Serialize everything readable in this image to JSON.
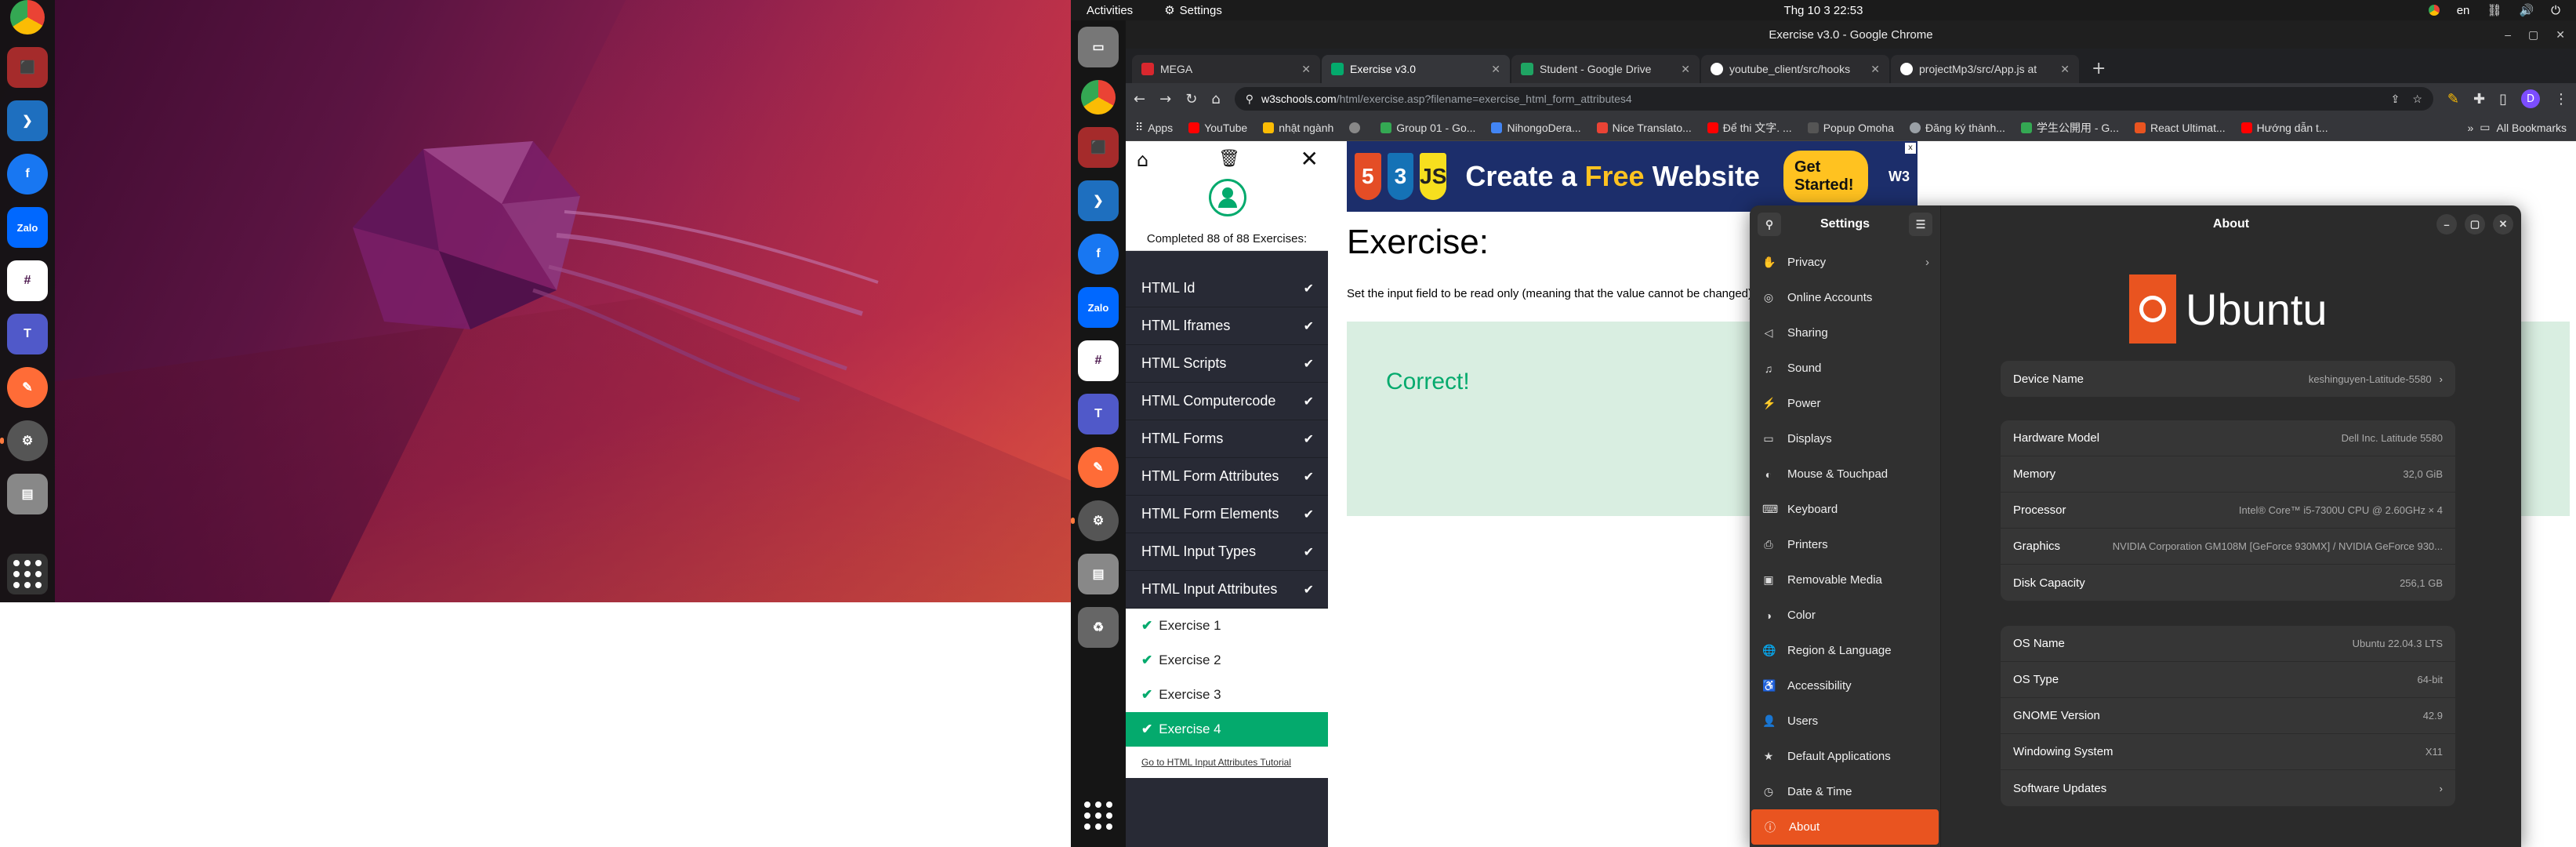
{
  "left_dock": {
    "apps": [
      "chrome-icon",
      "terminal-icon",
      "vscode-icon",
      "facebook-icon",
      "zalo-icon",
      "slack-icon",
      "teams-icon",
      "postman-icon",
      "settings-icon",
      "text-editor-icon"
    ]
  },
  "topbar": {
    "activities": "Activities",
    "app_indicator": "Settings",
    "clock": "Thg 10 3  22:53",
    "lang": "en"
  },
  "chrome": {
    "window_title": "Exercise v3.0 - Google Chrome",
    "tabs": [
      {
        "label": "MEGA",
        "color": "#d9272e"
      },
      {
        "label": "Exercise v3.0",
        "color": "#04aa6d"
      },
      {
        "label": "Student - Google Drive",
        "color": "#1fa463"
      },
      {
        "label": "youtube_client/src/hooks",
        "color": "#ffffff"
      },
      {
        "label": "projectMp3/src/App.js at",
        "color": "#ffffff"
      }
    ],
    "url_host": "w3schools.com",
    "url_path": "/html/exercise.asp?filename=exercise_html_form_attributes4",
    "bookmarks": [
      {
        "label": "Apps",
        "color": "#8ab4f8"
      },
      {
        "label": "YouTube",
        "color": "#ff0000"
      },
      {
        "label": "nhật ngành",
        "color": "#fbbc04"
      },
      {
        "label": "",
        "color": "#888888"
      },
      {
        "label": "Group 01 - Go...",
        "color": "#34a853"
      },
      {
        "label": "NihongoDera...",
        "color": "#4285f4"
      },
      {
        "label": "Nice Translato...",
        "color": "#ea4335"
      },
      {
        "label": "Để thi 文字. ...",
        "color": "#ff0000"
      },
      {
        "label": "Popup Omoha",
        "color": "#555555"
      },
      {
        "label": "Đăng ký thành...",
        "color": "#9aa0a6"
      },
      {
        "label": "学生公開用 - G...",
        "color": "#34a853"
      },
      {
        "label": "React Ultimat...",
        "color": "#e95420"
      },
      {
        "label": "Hướng dẫn t...",
        "color": "#ff0000"
      }
    ],
    "all_bookmarks": "All Bookmarks"
  },
  "exercise": {
    "completed": "Completed 88 of 88 Exercises:",
    "sections": [
      "HTML Id",
      "HTML Iframes",
      "HTML Scripts",
      "HTML Computercode",
      "HTML Forms",
      "HTML Form Attributes",
      "HTML Form Elements",
      "HTML Input Types",
      "HTML Input Attributes"
    ],
    "subitems": [
      "Exercise 1",
      "Exercise 2",
      "Exercise 3",
      "Exercise 4"
    ],
    "goto": "Go to HTML Input Attributes Tutorial",
    "title": "Exercise:",
    "description": "Set the input field to be read only (meaning that the value cannot be changed).",
    "result": "Correct!",
    "ad": {
      "headline_1": "Create a",
      "headline_free": "Free",
      "headline_2": "Website",
      "cta": "Get Started!",
      "brand": "W3",
      "close": "x"
    }
  },
  "settings": {
    "sidebar_title": "Settings",
    "window_title": "About",
    "nav": [
      {
        "label": "Privacy",
        "icon": "privacy-icon",
        "chev": true
      },
      {
        "label": "Online Accounts",
        "icon": "online-accounts-icon"
      },
      {
        "label": "Sharing",
        "icon": "sharing-icon"
      },
      {
        "label": "Sound",
        "icon": "sound-icon"
      },
      {
        "label": "Power",
        "icon": "power-icon"
      },
      {
        "label": "Displays",
        "icon": "displays-icon"
      },
      {
        "label": "Mouse & Touchpad",
        "icon": "mouse-icon"
      },
      {
        "label": "Keyboard",
        "icon": "keyboard-icon"
      },
      {
        "label": "Printers",
        "icon": "printer-icon"
      },
      {
        "label": "Removable Media",
        "icon": "removable-media-icon"
      },
      {
        "label": "Color",
        "icon": "color-icon"
      },
      {
        "label": "Region & Language",
        "icon": "region-icon"
      },
      {
        "label": "Accessibility",
        "icon": "accessibility-icon"
      },
      {
        "label": "Users",
        "icon": "users-icon"
      },
      {
        "label": "Default Applications",
        "icon": "default-apps-icon"
      },
      {
        "label": "Date & Time",
        "icon": "date-time-icon"
      },
      {
        "label": "About",
        "icon": "about-icon",
        "selected": true
      }
    ],
    "logo_text": "Ubuntu",
    "device": {
      "k": "Device Name",
      "v": "keshinguyen-Latitude-5580"
    },
    "hardware": [
      {
        "k": "Hardware Model",
        "v": "Dell Inc. Latitude 5580"
      },
      {
        "k": "Memory",
        "v": "32,0 GiB"
      },
      {
        "k": "Processor",
        "v": "Intel® Core™ i5-7300U CPU @ 2.60GHz × 4"
      },
      {
        "k": "Graphics",
        "v": "NVIDIA Corporation GM108M [GeForce 930MX] / NVIDIA GeForce 930..."
      },
      {
        "k": "Disk Capacity",
        "v": "256,1 GB"
      }
    ],
    "os": [
      {
        "k": "OS Name",
        "v": "Ubuntu 22.04.3 LTS"
      },
      {
        "k": "OS Type",
        "v": "64-bit"
      },
      {
        "k": "GNOME Version",
        "v": "42.9"
      },
      {
        "k": "Windowing System",
        "v": "X11"
      },
      {
        "k": "Software Updates",
        "v": ""
      }
    ],
    "accent": "#e95420"
  }
}
